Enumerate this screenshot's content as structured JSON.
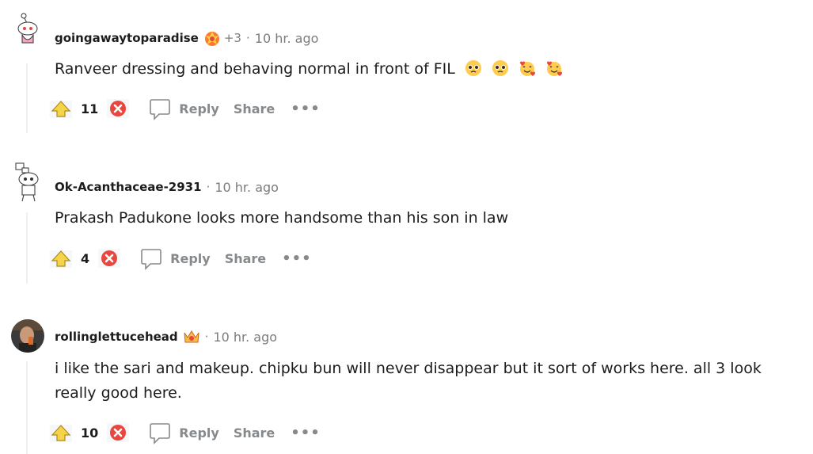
{
  "comments": [
    {
      "username": "goingawaytoparadise",
      "flair_icon": "fire-award-icon",
      "extra": "+3",
      "time": "10 hr. ago",
      "body": "Ranveer dressing and behaving normal in front of FIL",
      "emojis": [
        "pleading-face-icon",
        "pleading-face-icon",
        "smiling-face-with-hearts-icon",
        "smiling-face-with-hearts-icon"
      ],
      "score": "11",
      "reply_label": "Reply",
      "share_label": "Share",
      "more_label": "•••"
    },
    {
      "username": "Ok-Acanthaceae-2931",
      "time": "10 hr. ago",
      "body": "Prakash Padukone looks more handsome than his son in law",
      "score": "4",
      "reply_label": "Reply",
      "share_label": "Share",
      "more_label": "•••"
    },
    {
      "username": "rollinglettucehead",
      "flair_icon": "crown-award-icon",
      "time": "10 hr. ago",
      "body": "i like the sari and makeup. chipku bun will never disappear but it sort of works here. all 3 look really good here.",
      "score": "10",
      "reply_label": "Reply",
      "share_label": "Share",
      "more_label": "•••"
    }
  ],
  "separator": "·",
  "colors": {
    "text": "#1c1c1c",
    "muted": "#7c7c7c",
    "action": "#878a8c",
    "thread_line": "#edeff1",
    "upvote_fill": "#f5d44a",
    "downvote_fill": "#e8473f"
  }
}
